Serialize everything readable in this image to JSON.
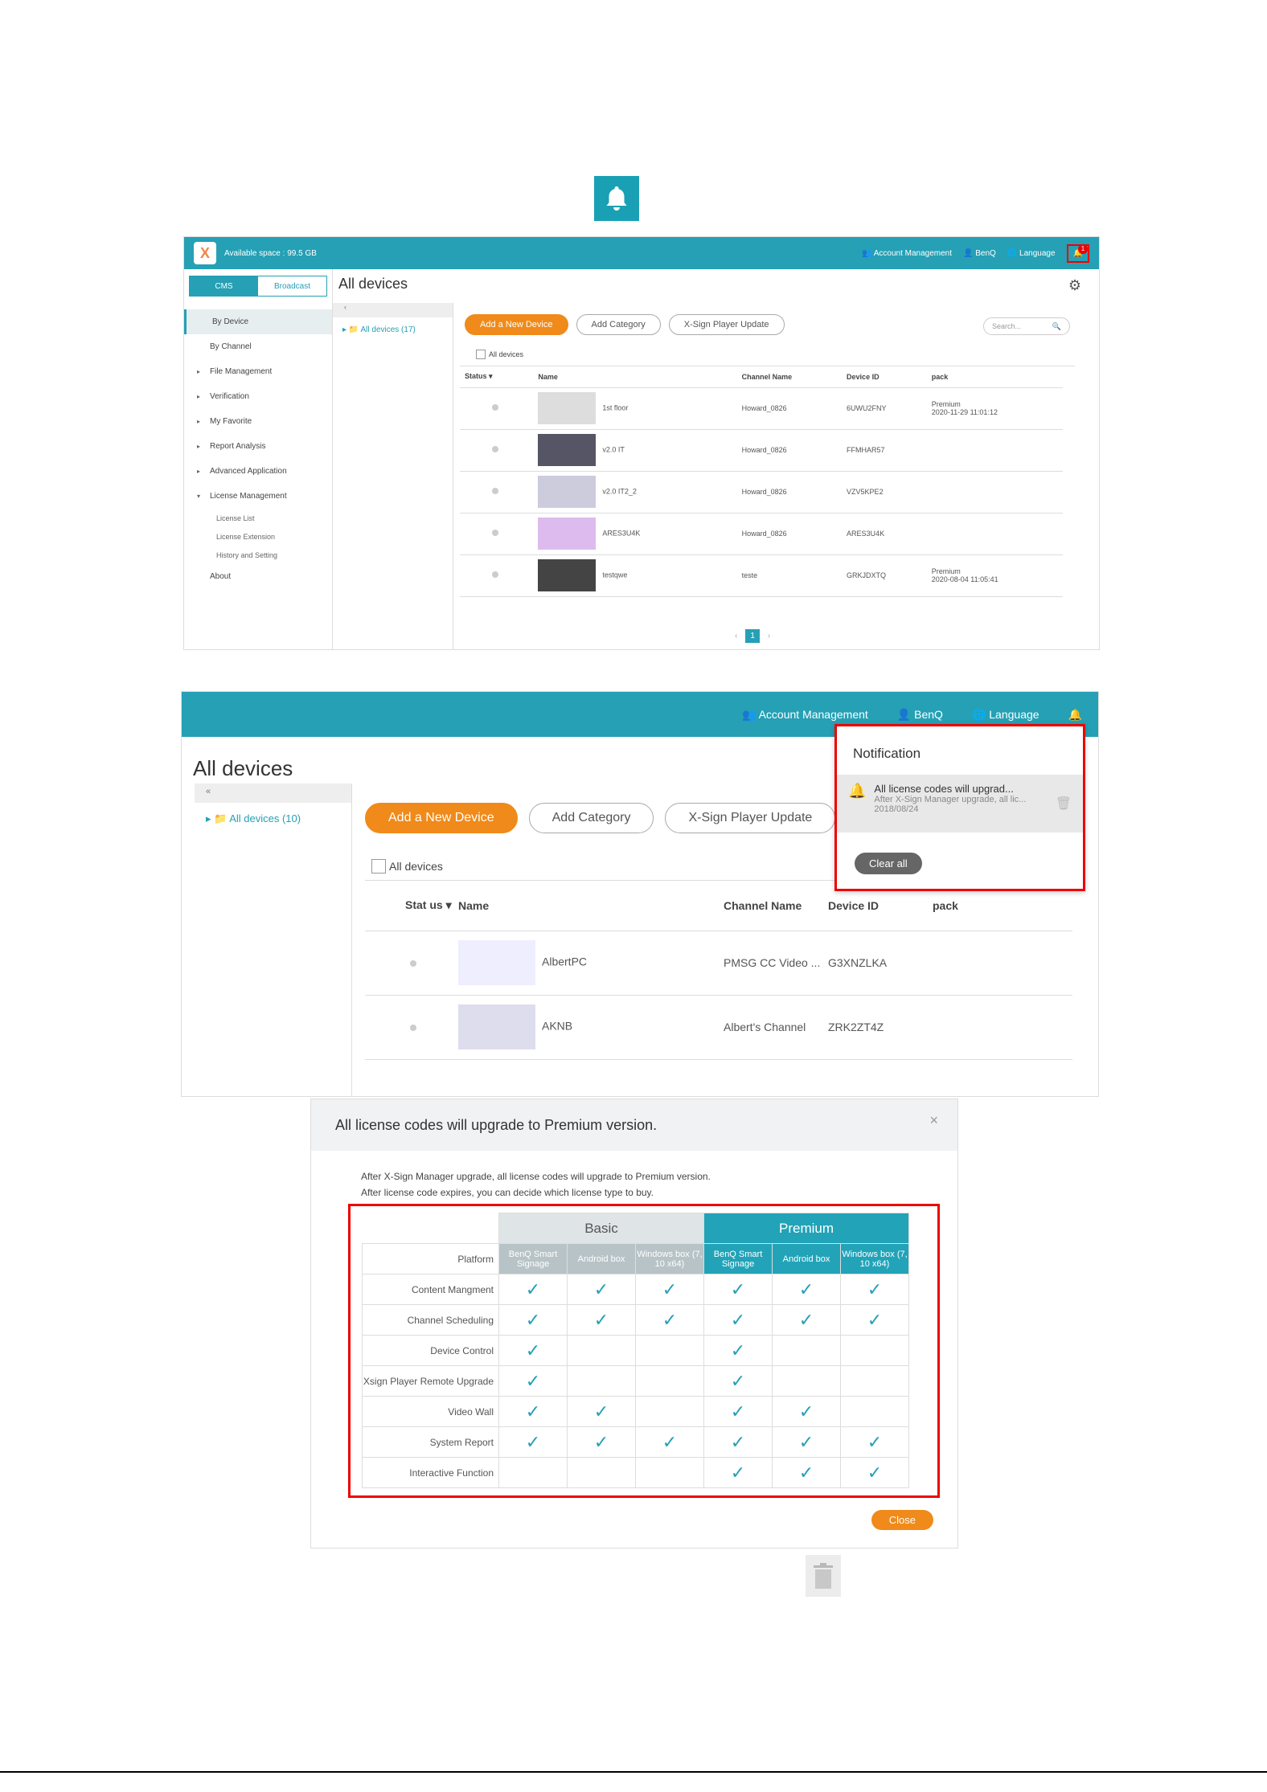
{
  "panel1": {
    "available_space": "Available space : 99.5 GB",
    "account_management": "Account Management",
    "user": "BenQ",
    "language": "Language",
    "badge_count": "1",
    "tabs": [
      "CMS",
      "Broadcast"
    ],
    "title": "All devices",
    "nav": [
      {
        "label": "By Device",
        "arrow": ""
      },
      {
        "label": "By Channel",
        "arrow": ""
      },
      {
        "label": "File Management",
        "arrow": "▸"
      },
      {
        "label": "Verification",
        "arrow": "▸"
      },
      {
        "label": "My Favorite",
        "arrow": "▸"
      },
      {
        "label": "Report Analysis",
        "arrow": "▸"
      },
      {
        "label": "Advanced Application",
        "arrow": "▸"
      },
      {
        "label": "License Management",
        "arrow": "▾"
      }
    ],
    "subnav": [
      "License List",
      "License Extension",
      "History and Setting"
    ],
    "about": "About",
    "tree_item": "All devices (17)",
    "collapse": "‹",
    "buttons": [
      "Add a New Device",
      "Add Category",
      "X-Sign Player Update"
    ],
    "search_placeholder": "Search...",
    "all_devices_check": "All devices",
    "columns": [
      "Status",
      "Name",
      "Channel Name",
      "Device ID",
      "pack"
    ],
    "rows": [
      {
        "name": "1st floor",
        "channel": "Howard_0826",
        "id": "6UWU2FNY",
        "pack": "Premium",
        "pack_date": "2020-11-29 11:01:12"
      },
      {
        "name": "v2.0 IT",
        "channel": "Howard_0826",
        "id": "FFMHAR57",
        "pack": "",
        "pack_date": ""
      },
      {
        "name": "v2.0 IT2_2",
        "channel": "Howard_0826",
        "id": "VZV5KPE2",
        "pack": "",
        "pack_date": ""
      },
      {
        "name": "ARES3U4K",
        "channel": "Howard_0826",
        "id": "ARES3U4K",
        "pack": "",
        "pack_date": ""
      },
      {
        "name": "testqwe",
        "channel": "teste",
        "id": "GRKJDXTQ",
        "pack": "Premium",
        "pack_date": "2020-08-04 11:05:41"
      }
    ],
    "page": "1"
  },
  "panel2": {
    "account_management": "Account Management",
    "user": "BenQ",
    "language": "Language",
    "title": "All devices",
    "collapse": "«",
    "tree_item": "All devices (10)",
    "buttons": [
      "Add a New Device",
      "Add Category",
      "X-Sign Player Update"
    ],
    "all_devices_check": "All devices",
    "columns": [
      "Stat us",
      "Name",
      "Channel Name",
      "Device ID",
      "pack"
    ],
    "rows": [
      {
        "name": "AlbertPC",
        "channel": "PMSG CC Video ...",
        "id": "G3XNZLKA"
      },
      {
        "name": "AKNB",
        "channel": "Albert's Channel",
        "id": "ZRK2ZT4Z"
      }
    ],
    "notification": {
      "title": "Notification",
      "item_title": "All license codes will upgrad...",
      "item_desc": "After X-Sign Manager upgrade, all lic...",
      "item_date": "2018/08/24",
      "clear_all": "Clear all"
    }
  },
  "dialog": {
    "title": "All license codes will upgrade to Premium version.",
    "close_x": "×",
    "line1": "After X-Sign Manager upgrade, all license codes will upgrade to Premium version.",
    "line2": "After license code expires, you can decide which license type to buy.",
    "basic": "Basic",
    "premium": "Premium",
    "platform_label": "Platform",
    "platforms": [
      "BenQ Smart Signage",
      "Android box",
      "Windows box (7, 10 x64)",
      "BenQ Smart Signage",
      "Android box",
      "Windows box (7, 10 x64)"
    ],
    "features": [
      {
        "label": "Content Mangment",
        "checks": [
          true,
          true,
          true,
          true,
          true,
          true
        ]
      },
      {
        "label": "Channel Scheduling",
        "checks": [
          true,
          true,
          true,
          true,
          true,
          true
        ]
      },
      {
        "label": "Device Control",
        "checks": [
          true,
          false,
          false,
          true,
          false,
          false
        ]
      },
      {
        "label": "Xsign Player Remote Upgrade",
        "checks": [
          true,
          false,
          false,
          true,
          false,
          false
        ]
      },
      {
        "label": "Video Wall",
        "checks": [
          true,
          true,
          false,
          true,
          true,
          false
        ]
      },
      {
        "label": "System Report",
        "checks": [
          true,
          true,
          true,
          true,
          true,
          true
        ]
      },
      {
        "label": "Interactive Function",
        "checks": [
          false,
          false,
          false,
          true,
          true,
          true
        ]
      }
    ],
    "close_button": "Close"
  },
  "colors": {
    "teal": "#25a0b5",
    "orange": "#f08a1a",
    "highlight": "#ee0000"
  }
}
